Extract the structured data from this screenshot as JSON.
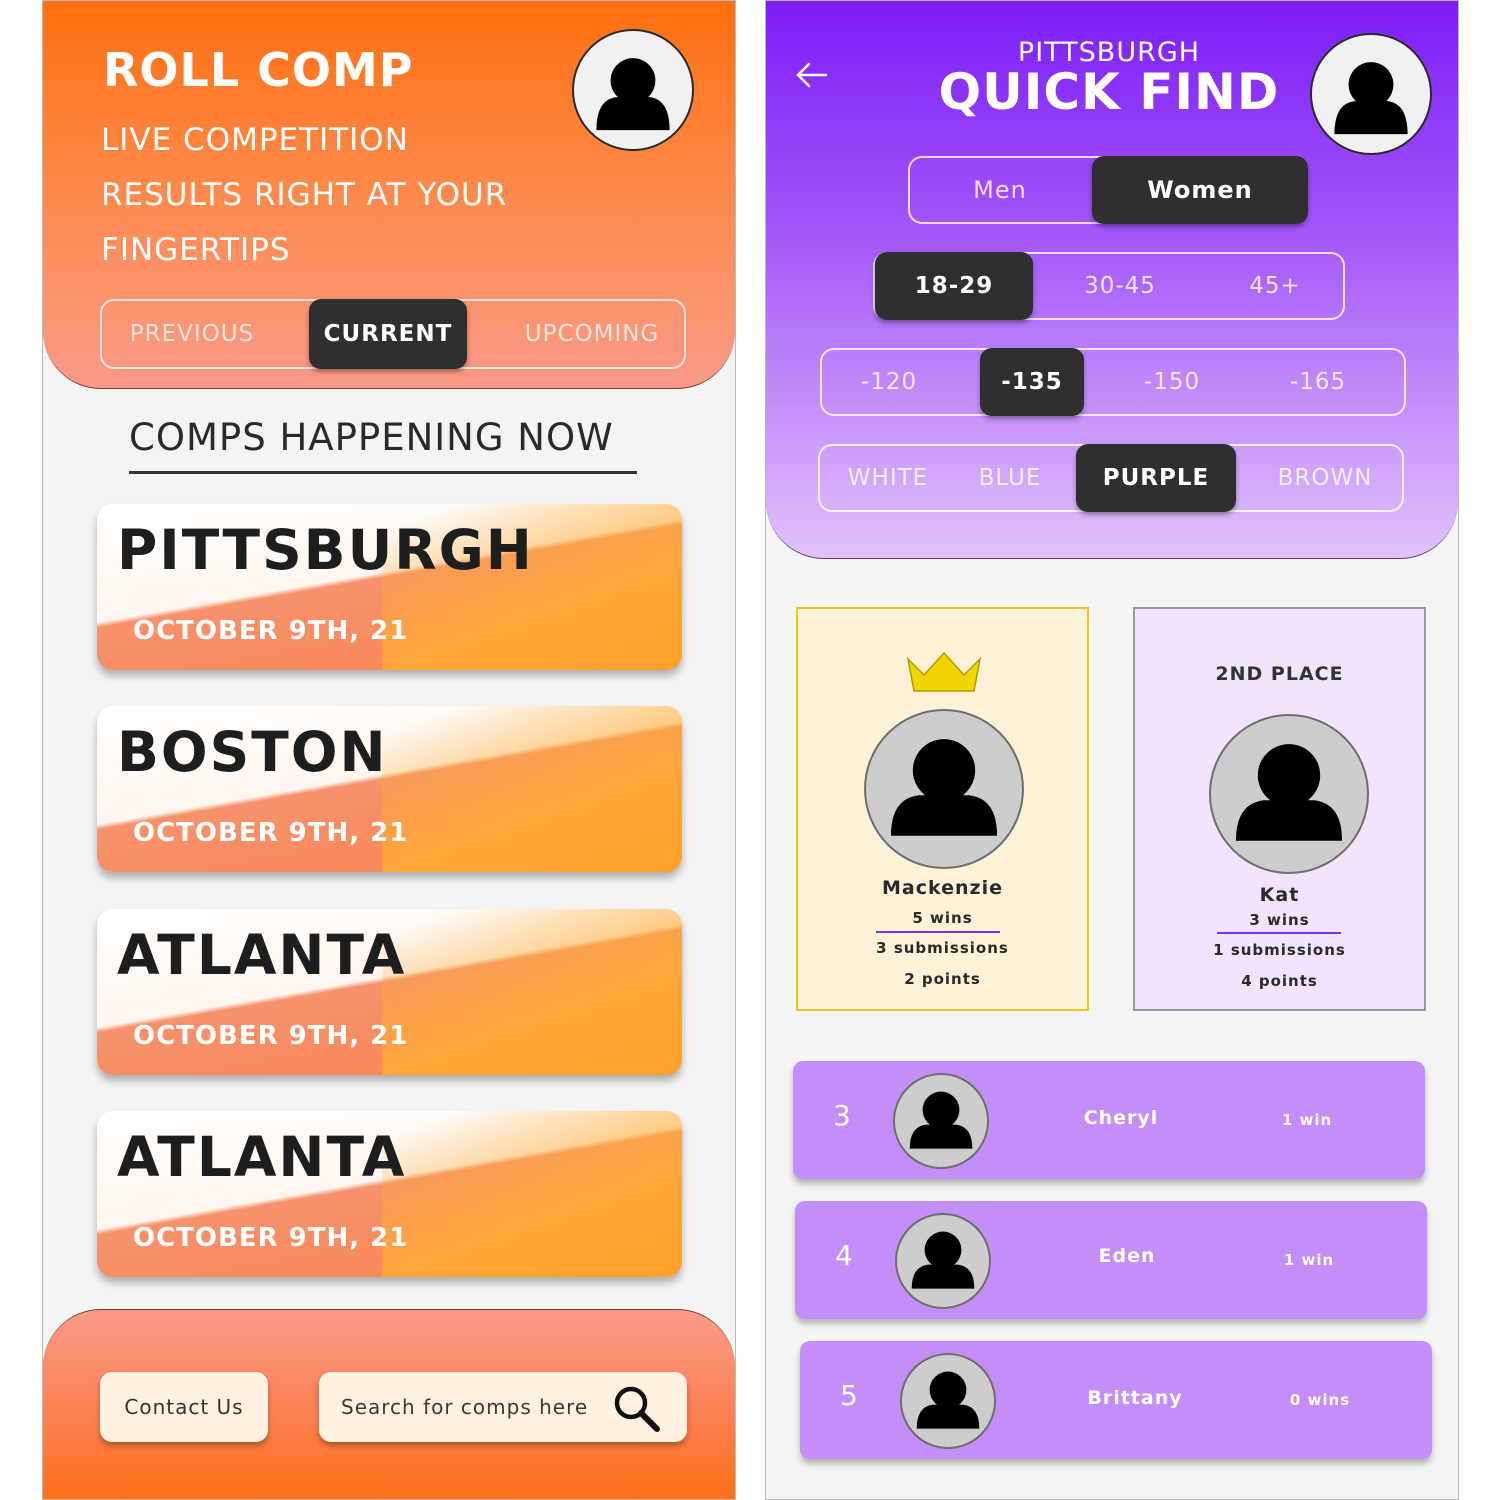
{
  "home": {
    "app_title": "ROLL COMP",
    "tagline_lines": [
      "LIVE COMPETITION",
      "RESULTS RIGHT AT YOUR",
      "FINGERTIPS"
    ],
    "tabs": [
      {
        "label": "PREVIOUS",
        "active": false
      },
      {
        "label": "CURRENT",
        "active": true
      },
      {
        "label": "UPCOMING",
        "active": false
      }
    ],
    "section_title": "COMPS HAPPENING NOW",
    "comps": [
      {
        "city": "PITTSBURGH",
        "date": "OCTOBER 9TH, 21"
      },
      {
        "city": "BOSTON",
        "date": "OCTOBER 9TH, 21"
      },
      {
        "city": "ATLANTA",
        "date": "OCTOBER 9TH, 21"
      },
      {
        "city": "ATLANTA",
        "date": "OCTOBER 9TH, 21"
      }
    ],
    "footer": {
      "contact_label": "Contact Us",
      "search_placeholder": "Search for comps here"
    }
  },
  "quick_find": {
    "city": "PITTSBURGH",
    "title": "QUICK FIND",
    "gender": [
      {
        "label": "Men",
        "active": false
      },
      {
        "label": "Women",
        "active": true
      }
    ],
    "age": [
      {
        "label": "18-29",
        "active": true
      },
      {
        "label": "30-45",
        "active": false
      },
      {
        "label": "45+",
        "active": false
      }
    ],
    "weight": [
      {
        "label": "-120",
        "active": false
      },
      {
        "label": "-135",
        "active": true
      },
      {
        "label": "-150",
        "active": false
      },
      {
        "label": "-165",
        "active": false
      }
    ],
    "belt": [
      {
        "label": "WHITE",
        "active": false
      },
      {
        "label": "BLUE",
        "active": false
      },
      {
        "label": "PURPLE",
        "active": true
      },
      {
        "label": "BROWN",
        "active": false
      }
    ],
    "first_place": {
      "name": "Mackenzie",
      "wins": "5 wins",
      "submissions": "3 submissions",
      "points": "2 points"
    },
    "second_place": {
      "label": "2ND PLACE",
      "name": "Kat",
      "wins": "3 wins",
      "submissions": "1 submissions",
      "points": "4 points"
    },
    "rankings": [
      {
        "rank": "3",
        "name": "Cheryl",
        "wins": "1 win"
      },
      {
        "rank": "4",
        "name": "Eden",
        "wins": "1 win"
      },
      {
        "rank": "5",
        "name": "Brittany",
        "wins": "0 wins"
      }
    ]
  },
  "colors": {
    "orange_accent": "#ff7010",
    "purple_accent": "#7d1cf7",
    "active_segment": "#2f2f2f",
    "gold_crown": "#f2d400",
    "rank_row": "#c38ef7"
  }
}
